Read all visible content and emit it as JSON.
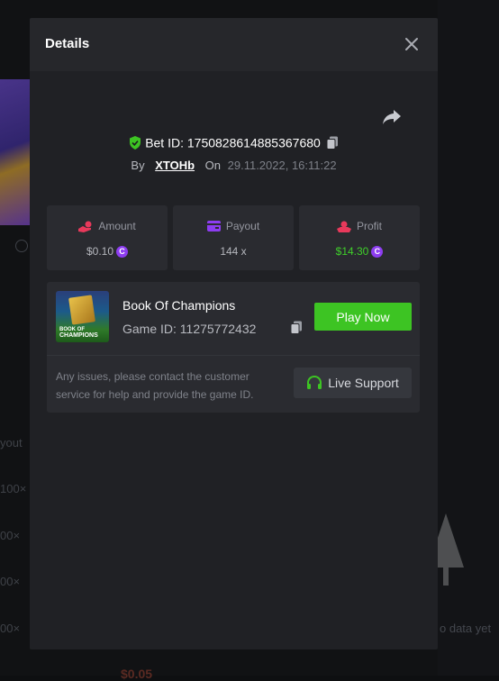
{
  "modal": {
    "title": "Details",
    "bet_id": "Bet ID: 1750828614885367680",
    "by_label": "By",
    "username": "XTOHb",
    "on_label": "On",
    "date": "29.11.2022, 16:11:22"
  },
  "stats": {
    "amount": {
      "label": "Amount",
      "value": "$0.10"
    },
    "payout": {
      "label": "Payout",
      "value": "144 x"
    },
    "profit": {
      "label": "Profit",
      "value": "$14.30"
    }
  },
  "game": {
    "title": "Book Of Champions",
    "game_id": "Game ID: 11275772432",
    "play_label": "Play Now",
    "thumb_text_1": "BOOK OF",
    "thumb_text_2": "CHAMPIONS"
  },
  "support": {
    "text": "Any issues, please contact the customer service for help and provide the game ID.",
    "button_label": "Live Support"
  },
  "background": {
    "col_labels": [
      "yout",
      "100×",
      "00×",
      "00×",
      "00×"
    ],
    "no_data": "o data yet",
    "bottom_amount": "$0.05"
  },
  "colors": {
    "accent_green": "#3dc423",
    "coin_purple": "#8d3df0",
    "amount_icon": "#e8395b",
    "payout_icon": "#8d3df0",
    "profit_icon": "#e8395b"
  }
}
